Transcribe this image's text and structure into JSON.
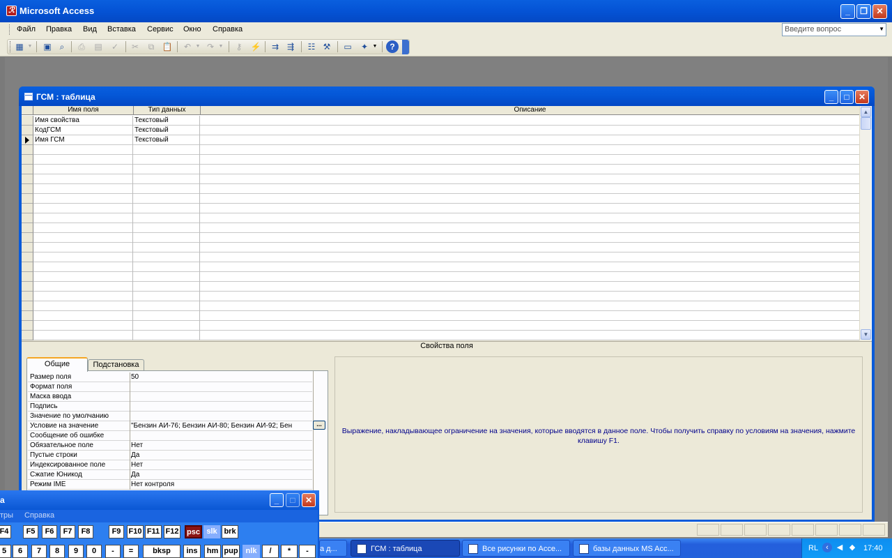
{
  "app": {
    "title": "Microsoft Access",
    "ask_placeholder": "Введите вопрос"
  },
  "menu": [
    "Файл",
    "Правка",
    "Вид",
    "Вставка",
    "Сервис",
    "Окно",
    "Справка"
  ],
  "toolbar_icons": [
    "view-icon",
    "save-icon",
    "print-preview-icon",
    "print-icon",
    "preview-icon",
    "spelling-icon",
    "cut-icon",
    "copy-icon",
    "paste-icon",
    "undo-icon",
    "redo-icon",
    "primary-key-icon",
    "indexes-icon",
    "insert-rows-icon",
    "delete-rows-icon",
    "properties-icon",
    "build-icon",
    "database-window-icon",
    "new-object-icon",
    "help-icon"
  ],
  "table_window": {
    "title": "ГСМ : таблица",
    "columns": [
      "Имя поля",
      "Тип данных",
      "Описание"
    ],
    "rows": [
      {
        "name": "Имя свойства",
        "type": "Текстовый",
        "desc": ""
      },
      {
        "name": "КодГСМ",
        "type": "Текстовый",
        "desc": ""
      },
      {
        "name": "Имя ГСМ",
        "type": "Текстовый",
        "desc": ""
      }
    ]
  },
  "field_properties": {
    "title": "Свойства поля",
    "tabs": [
      "Общие",
      "Подстановка"
    ],
    "properties": [
      {
        "label": "Размер поля",
        "value": "50"
      },
      {
        "label": "Формат поля",
        "value": ""
      },
      {
        "label": "Маска ввода",
        "value": ""
      },
      {
        "label": "Подпись",
        "value": ""
      },
      {
        "label": "Значение по умолчанию",
        "value": ""
      },
      {
        "label": "Условие на значение",
        "value": "\"Бензин АИ-76; Бензин АИ-80; Бензин АИ-92; Бен"
      },
      {
        "label": "Сообщение об ошибке",
        "value": ""
      },
      {
        "label": "Обязательное поле",
        "value": "Нет"
      },
      {
        "label": "Пустые строки",
        "value": "Да"
      },
      {
        "label": "Индексированное поле",
        "value": "Нет"
      },
      {
        "label": "Сжатие Юникод",
        "value": "Да"
      },
      {
        "label": "Режим IME",
        "value": "Нет контроля"
      }
    ],
    "build_button": "...",
    "hint": "Выражение, накладывающее ограничение на значения, которые вводятся в данное поле.  Чтобы получить справку по условиям на значения, нажмите клавишу F1."
  },
  "keyboard": {
    "title": "а",
    "menu": [
      "тры",
      "Справка"
    ],
    "row1": [
      "F4",
      "F5",
      "F6",
      "F7",
      "F8",
      "F9",
      "F10",
      "F11",
      "F12",
      "psc",
      "slk",
      "brk"
    ],
    "row2": [
      "5",
      "6",
      "7",
      "8",
      "9",
      "0",
      "-",
      "=",
      "bksp",
      "ins",
      "hm",
      "pup",
      "nlk",
      "/",
      "*",
      "-"
    ]
  },
  "taskbar": {
    "items": [
      "а д...",
      "ГСМ : таблица",
      "Все рисунки по Acce...",
      "базы данных MS Acc..."
    ],
    "lang": "RL",
    "clock": "17:40"
  }
}
